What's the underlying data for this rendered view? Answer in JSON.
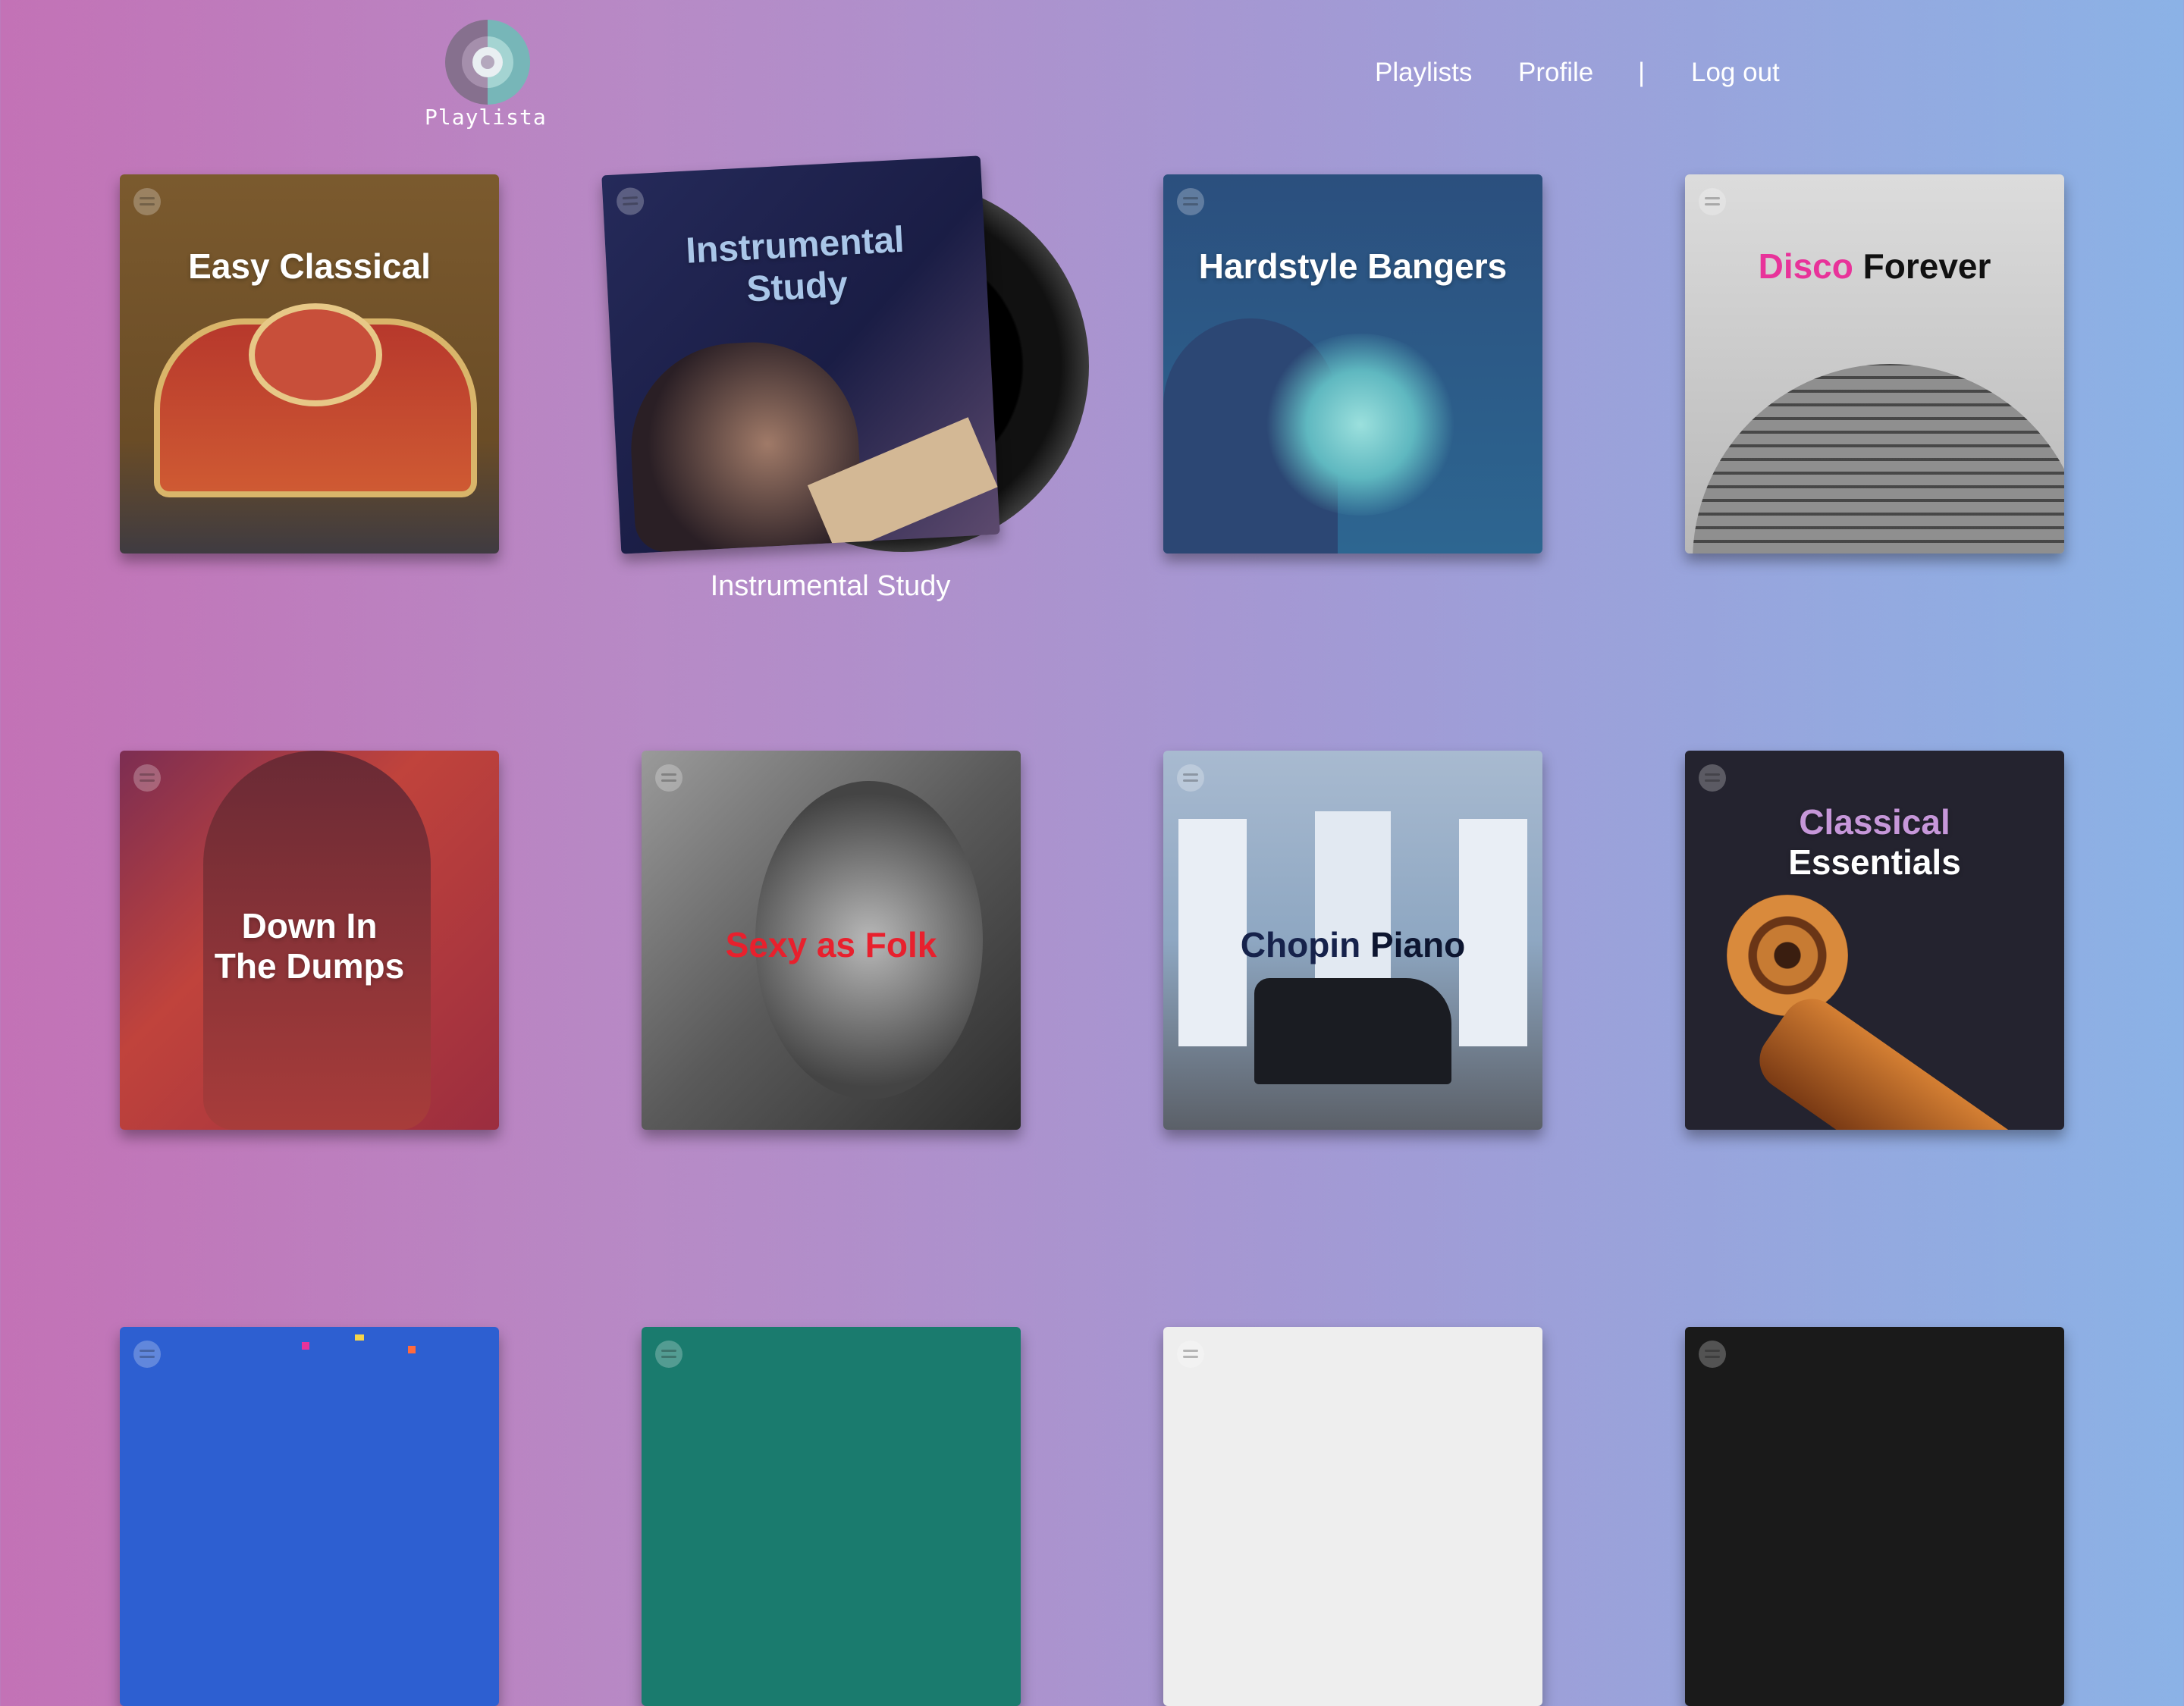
{
  "app": {
    "logo_text": "Playlista"
  },
  "nav": {
    "playlists": "Playlists",
    "profile": "Profile",
    "separator": "|",
    "logout": "Log out"
  },
  "playlists": [
    {
      "title": "Easy Classical",
      "cover_bg": "#7a5a2e"
    },
    {
      "title_line1": "Instrumental",
      "title_line2": "Study",
      "caption": "Instrumental Study",
      "cover_bg": "#1e2352",
      "title_color": "#a9c6e8"
    },
    {
      "title": "Hardstyle Bangers",
      "cover_bg": "#2e5d88"
    },
    {
      "title_part1": "Disco",
      "title_part2": "Forever",
      "cover_bg": "#cfcfcf",
      "accent_color": "#e8339a"
    },
    {
      "title_line1": "Down In",
      "title_line2": "The Dumps",
      "cover_bg": "#9a2c3c"
    },
    {
      "title": "Sexy as Folk",
      "cover_bg": "#6d6d6d",
      "title_color": "#e8202d"
    },
    {
      "title_part1": "Chopin",
      "title_part2": "Piano",
      "cover_bg": "#8fa4bb",
      "title_color": "#16224b"
    },
    {
      "title_line1": "Classical",
      "title_line2": "Essentials",
      "cover_bg": "#232331",
      "accent_color": "#c697d9"
    },
    {
      "title": "",
      "cover_bg": "#2d5fd1"
    },
    {
      "title": "",
      "cover_bg": "#1a7b6e"
    },
    {
      "title": "",
      "cover_bg": "#eeeeee"
    },
    {
      "title": "",
      "cover_bg": "#1a1a1a"
    }
  ]
}
